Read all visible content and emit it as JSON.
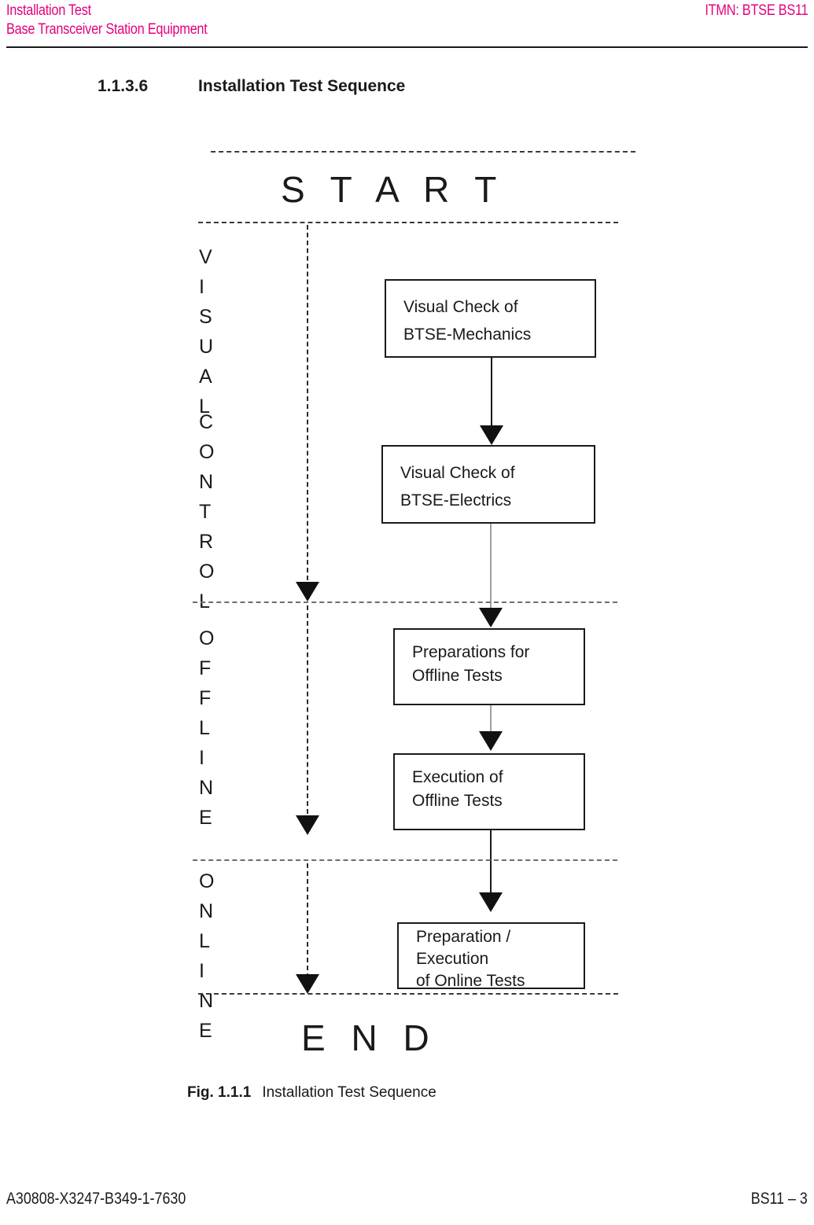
{
  "header": {
    "left_line1": "Installation Test",
    "left_line2": "Base Transceiver Station Equipment",
    "right": "ITMN: BTSE BS11",
    "color": "#e5007d"
  },
  "section": {
    "number": "1.1.3.6",
    "title": "Installation Test Sequence"
  },
  "figure": {
    "start_label": "S T A R T",
    "end_label": "E N D",
    "caption_label": "Fig.  1.1.1",
    "caption_text": "Installation Test Sequence",
    "phases": [
      {
        "name": "visual-control",
        "letters": "V I S U A L"
      },
      {
        "name": "visual-control-2",
        "letters": "C O N T R O L"
      },
      {
        "name": "offline",
        "letters": "O F F L I N E"
      },
      {
        "name": "online",
        "letters": "O N L I N E"
      }
    ],
    "nodes": [
      {
        "id": "visual-check-mechanics",
        "line1": "Visual Check of",
        "line2": "BTSE-Mechanics",
        "line3": ""
      },
      {
        "id": "visual-check-electrics",
        "line1": "Visual Check of",
        "line2": "BTSE-Electrics",
        "line3": ""
      },
      {
        "id": "preparations-offline-tests",
        "line1": "Preparations for",
        "line2": "Offline Tests",
        "line3": ""
      },
      {
        "id": "execution-offline-tests",
        "line1": "Execution of",
        "line2": "Offline Tests",
        "line3": ""
      },
      {
        "id": "preparation-execution-online-tests",
        "line1": "Preparation /",
        "line2": "Execution",
        "line3": "of Online Tests"
      }
    ]
  },
  "footer": {
    "left": "A30808-X3247-B349-1-7630",
    "right": "BS11 – 3"
  }
}
